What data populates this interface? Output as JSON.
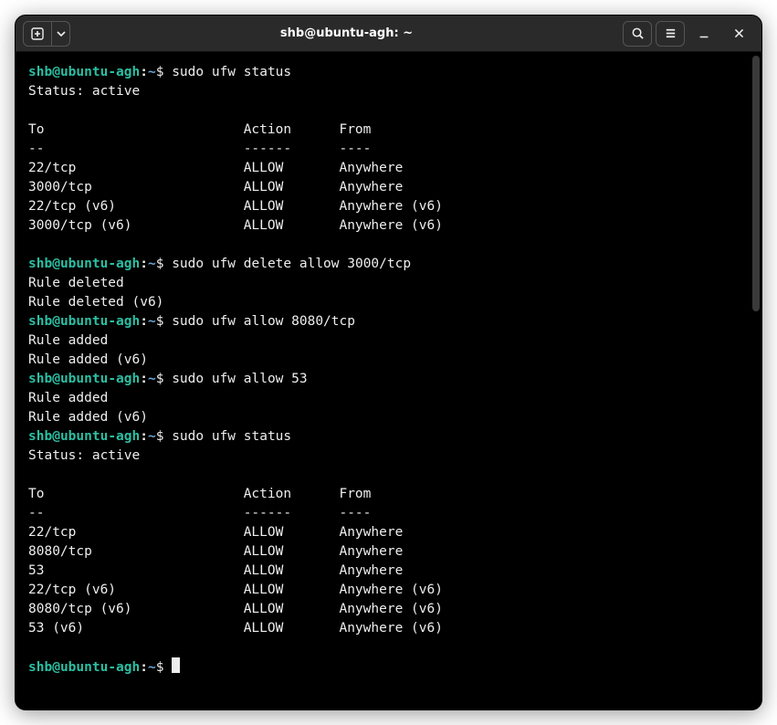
{
  "titlebar": {
    "title": "shb@ubuntu-agh: ~"
  },
  "prompt": {
    "user": "shb",
    "at": "@",
    "host": "ubuntu-agh",
    "colon": ":",
    "path": "~",
    "symbol": "$"
  },
  "blocks": [
    {
      "command": "sudo ufw status",
      "output": "Status: active\n\nTo                         Action      From\n--                         ------      ----\n22/tcp                     ALLOW       Anywhere\n3000/tcp                   ALLOW       Anywhere\n22/tcp (v6)                ALLOW       Anywhere (v6)\n3000/tcp (v6)              ALLOW       Anywhere (v6)\n"
    },
    {
      "command": "sudo ufw delete allow 3000/tcp",
      "output": "Rule deleted\nRule deleted (v6)"
    },
    {
      "command": "sudo ufw allow 8080/tcp",
      "output": "Rule added\nRule added (v6)"
    },
    {
      "command": "sudo ufw allow 53",
      "output": "Rule added\nRule added (v6)"
    },
    {
      "command": "sudo ufw status",
      "output": "Status: active\n\nTo                         Action      From\n--                         ------      ----\n22/tcp                     ALLOW       Anywhere\n8080/tcp                   ALLOW       Anywhere\n53                         ALLOW       Anywhere\n22/tcp (v6)                ALLOW       Anywhere (v6)\n8080/tcp (v6)              ALLOW       Anywhere (v6)\n53 (v6)                    ALLOW       Anywhere (v6)\n"
    },
    {
      "command": "",
      "output": null,
      "cursor": true
    }
  ]
}
